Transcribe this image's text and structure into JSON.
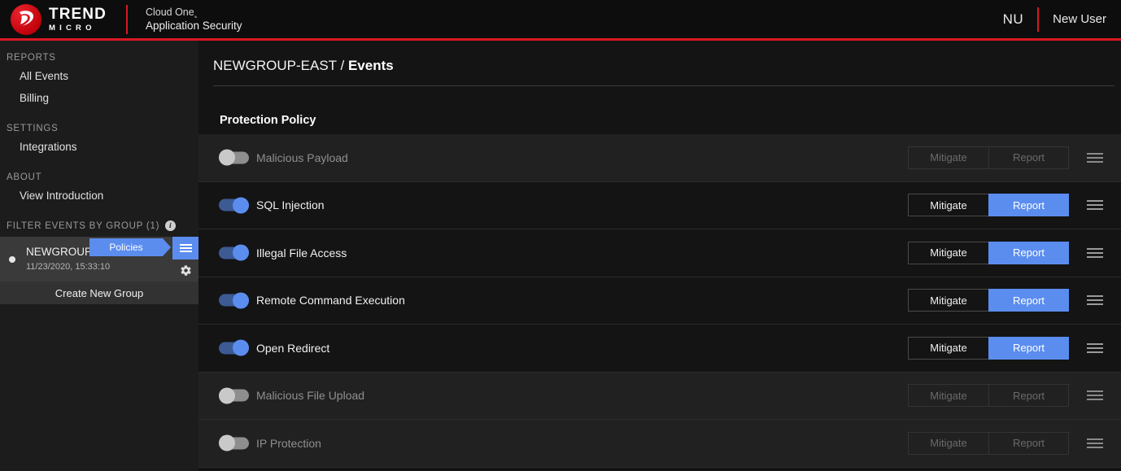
{
  "header": {
    "brand_top": "TREND",
    "brand_bottom": "MICRO",
    "product_line1": "Cloud One˻",
    "product_line2": "Application Security",
    "user_initials": "NU",
    "user_name": "New User",
    "accent_red": "#d71920"
  },
  "sidebar": {
    "sections": [
      {
        "label": "REPORTS"
      },
      {
        "label": "SETTINGS"
      },
      {
        "label": "ABOUT"
      }
    ],
    "items": [
      {
        "label": "All Events"
      },
      {
        "label": "Billing"
      },
      {
        "label": "Integrations"
      },
      {
        "label": "View Introduction"
      }
    ],
    "filter_label": "FILTER EVENTS BY GROUP (1)",
    "info_glyph": "i",
    "group": {
      "name": "NEWGROUP-EAST",
      "date": "11/23/2020, 15:33:10"
    },
    "tooltip": "Policies",
    "create_group_label": "Create New Group"
  },
  "main": {
    "breadcrumb_group": "NEWGROUP-EAST",
    "breadcrumb_separator": "/",
    "breadcrumb_current": "Events",
    "section_title": "Protection Policy",
    "buttons": {
      "mitigate": "Mitigate",
      "report": "Report"
    },
    "policies": [
      {
        "name": "Malicious Payload",
        "enabled": false
      },
      {
        "name": "SQL Injection",
        "enabled": true
      },
      {
        "name": "Illegal File Access",
        "enabled": true
      },
      {
        "name": "Remote Command Execution",
        "enabled": true
      },
      {
        "name": "Open Redirect",
        "enabled": true
      },
      {
        "name": "Malicious File Upload",
        "enabled": false
      },
      {
        "name": "IP Protection",
        "enabled": false
      }
    ],
    "colors": {
      "accent_blue": "#5b8def",
      "row_disabled_bg": "#212121",
      "row_enabled_bg": "#141414"
    }
  }
}
